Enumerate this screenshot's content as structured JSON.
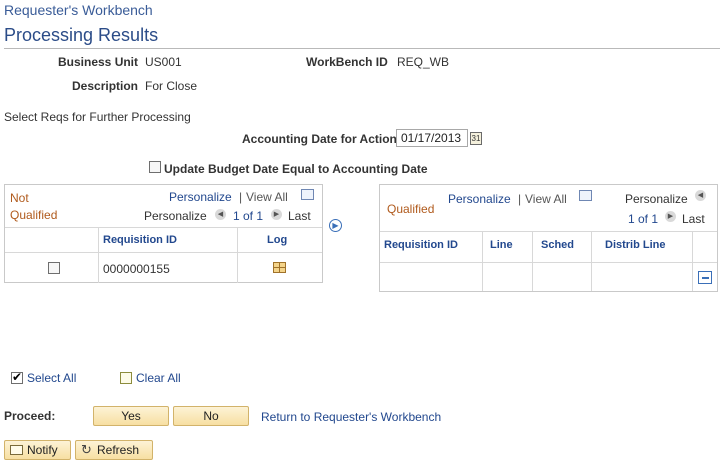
{
  "header": {
    "breadcrumb": "Requester's Workbench",
    "page_title": "Processing Results"
  },
  "fields": {
    "business_unit_label": "Business Unit",
    "business_unit_value": "US001",
    "workbench_id_label": "WorkBench ID",
    "workbench_id_value": "REQ_WB",
    "description_label": "Description",
    "description_value": "For Close"
  },
  "select_reqs_text": "Select Reqs for Further Processing",
  "accounting_date": {
    "label": "Accounting Date for Action",
    "value": "01/17/2013",
    "calendar_glyph": "31"
  },
  "update_budget": {
    "label": "Update Budget Date Equal to Accounting Date",
    "checked": false
  },
  "not_qualified_grid": {
    "title_line1": "Not",
    "title_line2": "Qualified",
    "personalize": "Personalize",
    "separator": "|",
    "view_all": "View All",
    "personalize2": "Personalize",
    "page_info": "1 of 1",
    "last": "Last",
    "columns": [
      "Requisition ID",
      "Log"
    ],
    "rows": [
      {
        "requisition_id": "0000000155",
        "checked": false
      }
    ]
  },
  "qualified_grid": {
    "title": "Qualified",
    "personalize": "Personalize",
    "separator": "|",
    "view_all": "View All",
    "personalize2": "Personalize",
    "page_info": "1 of 1",
    "last": "Last",
    "columns": [
      "Requisition ID",
      "Line",
      "Sched",
      "Distrib Line"
    ]
  },
  "move_button_glyph": "▶",
  "selection": {
    "select_all": "Select All",
    "clear_all": "Clear All"
  },
  "proceed": {
    "label": "Proceed:",
    "yes": "Yes",
    "no": "No",
    "return_link": "Return to Requester's Workbench"
  },
  "footer_buttons": {
    "notify": "Notify",
    "refresh": "Refresh"
  },
  "colors": {
    "link": "#22488e",
    "title": "#2b4c88",
    "qualified_label": "#b05a1c",
    "button_fill": "#f7dfa2"
  }
}
